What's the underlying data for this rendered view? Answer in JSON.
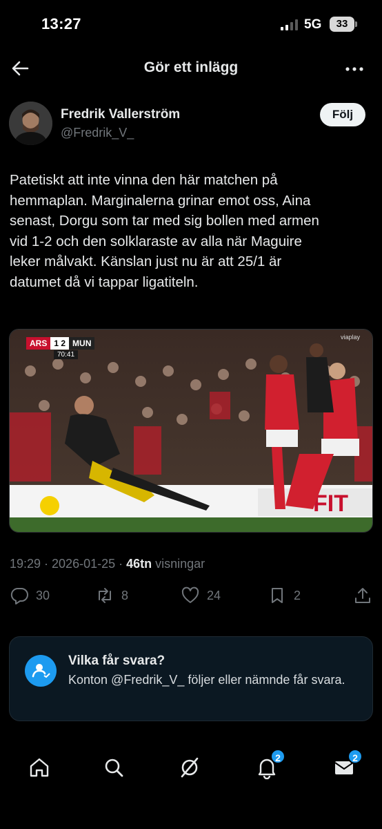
{
  "status_bar": {
    "time": "13:27",
    "network": "5G",
    "battery": "33"
  },
  "header": {
    "title": "Gör ett inlägg",
    "back_icon": "arrow-left-icon",
    "more_icon": "more-horizontal-icon"
  },
  "author": {
    "name": "Fredrik Vallerström",
    "handle": "@Fredrik_V_",
    "follow_label": "Följ"
  },
  "post": {
    "text": "Patetiskt att inte vinna den här matchen på\nhemmaplan. Marginalerna grinar emot oss, Aina\nsenast, Dorgu som tar med sig bollen med armen\nvid 1-2 och den solklaraste av alla när Maguire\nleker målvakt. Känslan just nu är att 25/1 är\ndatumet då vi tappar ligatiteln.",
    "media": {
      "home_team": "ARS",
      "score": "1 2",
      "away_team": "MUN",
      "clock": "70:41",
      "watermark": "viaplay"
    },
    "timestamp": "19:29 · 2026-01-25 · ",
    "views_count": "46tn",
    "views_label": " visningar"
  },
  "actions": {
    "replies": "30",
    "reposts": "8",
    "likes": "24",
    "bookmarks": "2"
  },
  "reply_settings": {
    "title": "Vilka får svara?",
    "body": "Konton @Fredrik_V_ följer eller nämnde får svara."
  },
  "bottom_nav": {
    "notifications_badge": "2",
    "messages_badge": "2"
  },
  "colors": {
    "background": "#000000",
    "accent": "#1d9bf0",
    "secondary_text": "#71767b"
  }
}
